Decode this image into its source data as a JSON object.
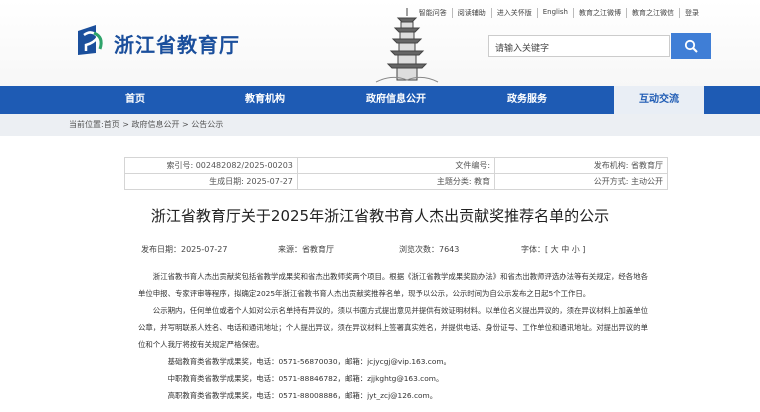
{
  "header": {
    "site_title": "浙江省教育厅",
    "top_links": [
      "智能问答",
      "阅读辅助",
      "进入关怀版",
      "English",
      "教育之江微博",
      "教育之江微信",
      "登录"
    ],
    "search_placeholder": "请输入关键字",
    "icons": [
      "logo-icon",
      "search-icon",
      "pagoda-illustration"
    ]
  },
  "nav": {
    "items": [
      "首页",
      "教育机构",
      "政府信息公开",
      "政务服务",
      "互动交流"
    ],
    "active": "互动交流"
  },
  "breadcrumb": "当前位置:首页 > 政府信息公开 > 公告公示",
  "meta": {
    "index_no": "索引号: 002482082/2025-00203",
    "doc_no_label": "文件编号:",
    "publisher": "发布机构: 省教育厅",
    "date": "生成日期: 2025-07-27",
    "topic": "主题分类: 教育",
    "publish_method": "公开方式: 主动公开"
  },
  "article": {
    "title": "浙江省教育厅关于2025年浙江省教书育人杰出贡献奖推荐名单的公示",
    "publish_date": "发布日期：2025-07-27",
    "source": "来源：省教育厅",
    "views": "浏览次数：7643",
    "font_size": "字体：[ 大 中 小 ]",
    "para1": "浙江省教书育人杰出贡献奖包括省教学成果奖和省杰出教师奖两个项目。根据《浙江省教学成果奖励办法》和省杰出教师评选办法等有关规定，经各地各单位申报、专家评审等程序，拟确定2025年浙江省教书育人杰出贡献奖推荐名单，现予以公示，公示时间为自公示发布之日起5个工作日。",
    "para2": "公示期内，任何单位或者个人如对公示名单持有异议的，须以书面方式提出意见并提供有效证明材料。以单位名义提出异议的，须在异议材料上加盖单位公章，并写明联系人姓名、电话和通讯地址；个人提出异议，须在异议材料上签署真实姓名，并提供电话、身份证号、工作单位和通讯地址。对提出异议的单位和个人我厅将按有关规定严格保密。",
    "contacts": [
      "基础教育类省教学成果奖，电话：0571-56870030，邮箱：jcjycgj@vip.163.com。",
      "中职教育类省教学成果奖，电话：0571-88846782，邮箱：zjjkghtg@163.com。",
      "高职教育类省教学成果奖，电话：0571-88008886，邮箱：jyt_zcj@126.com。"
    ]
  }
}
